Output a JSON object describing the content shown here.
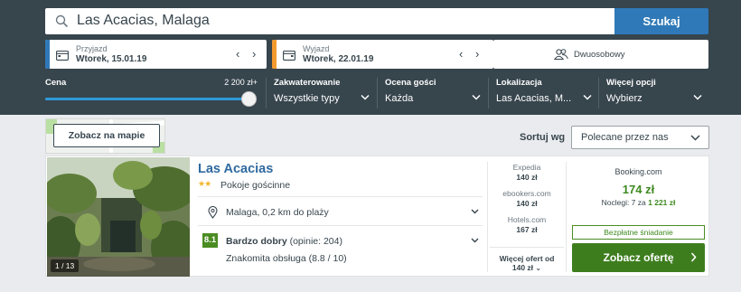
{
  "search": {
    "query": "Las Acacias, Malaga",
    "button_label": "Szukaj"
  },
  "dates": {
    "checkin_label": "Przyjazd",
    "checkin_value": "Wtorek, 15.01.19",
    "checkout_label": "Wyjazd",
    "checkout_value": "Wtorek, 22.01.19",
    "checkin_color": "#2f79b8",
    "checkout_color": "#f39a2e"
  },
  "room": {
    "label": "Dwuosobowy"
  },
  "filters": {
    "price_label": "Cena",
    "price_value": "2 200 zł+",
    "price_fill_fraction": 1.0,
    "lodging_label": "Zakwaterowanie",
    "lodging_value": "Wszystkie typy",
    "rating_label": "Ocena gości",
    "rating_value": "Każda",
    "location_label": "Lokalizacja",
    "location_value": "Las Acacias, M...",
    "more_label": "Więcej opcji",
    "more_value": "Wybierz"
  },
  "map": {
    "button_label": "Zobacz na mapie"
  },
  "sort": {
    "label": "Sortuj wg",
    "value": "Polecane przez nas"
  },
  "hotel": {
    "name": "Las Acacias",
    "stars": 2,
    "type": "Pokoje gościnne",
    "photo_counter": "1 / 13",
    "location": "Malaga, 0,2 km do plaży",
    "rating_score": "8.1",
    "rating_text": "Bardzo dobry",
    "rating_count": "(opinie: 204)",
    "rating_detail": "Znakomita obsługa (8.8 / 10)",
    "offers": [
      {
        "name": "Expedia",
        "price": "140 zł"
      },
      {
        "name": "ebookers.com",
        "price": "140 zł"
      },
      {
        "name": "Hotels.com",
        "price": "167 zł"
      }
    ],
    "more_offers_label": "Więcej ofert od",
    "more_offers_price": "140 zł",
    "best_provider": "Booking.com",
    "best_price": "174 zł",
    "nights_prefix": "Noclegi: 7 za",
    "nights_total": "1 221 zł",
    "breakfast": "Bezpłatne śniadanie",
    "deal_button": "Zobacz ofertę"
  }
}
